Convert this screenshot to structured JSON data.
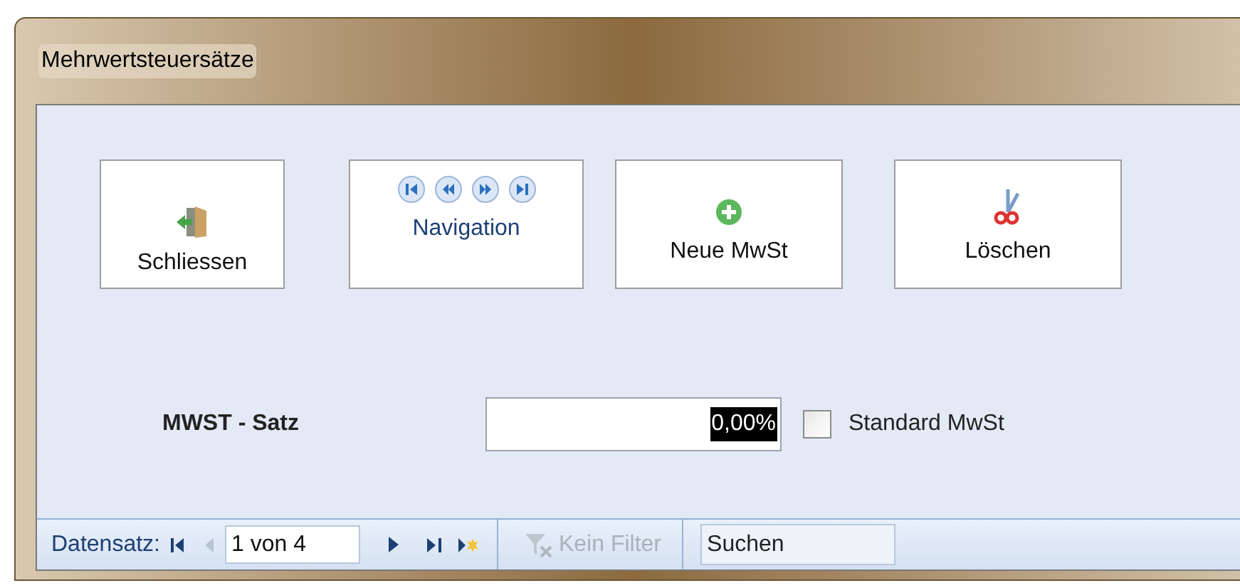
{
  "window": {
    "title": "Mehrwertsteuersätze"
  },
  "buttons": [
    {
      "kind": "close",
      "label": "Schliessen"
    },
    {
      "kind": "navigation",
      "label": "Navigation"
    },
    {
      "kind": "new",
      "label": "Neue MwSt"
    },
    {
      "kind": "delete",
      "label": "Löschen"
    }
  ],
  "field": {
    "label": "MWST - Satz",
    "value": "0,00%",
    "selected": true
  },
  "checkbox": {
    "label": "Standard MwSt",
    "checked": false
  },
  "record_bar": {
    "label": "Datensatz:",
    "position": "1 von 4",
    "filter": {
      "label": "Kein Filter",
      "disabled": true
    },
    "search": {
      "placeholder": "Suchen"
    }
  }
}
